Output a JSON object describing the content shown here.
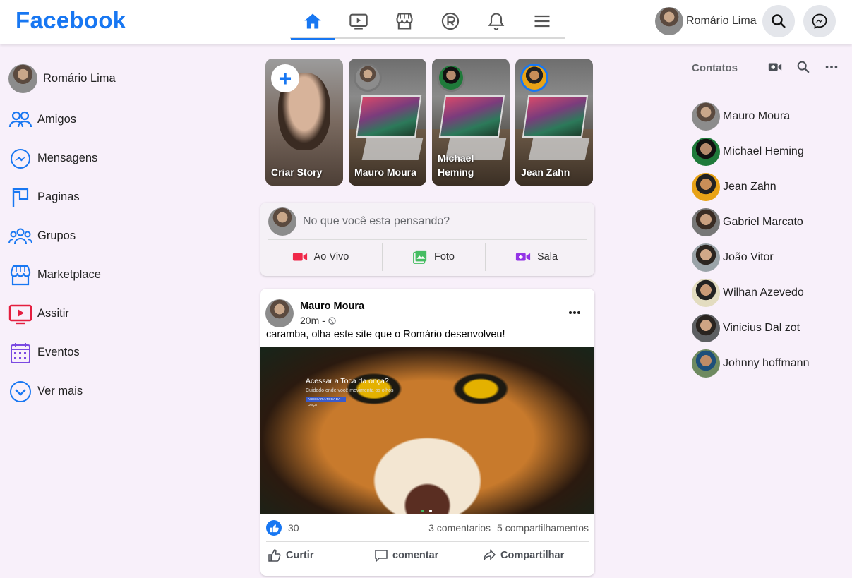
{
  "app": {
    "logo": "Facebook"
  },
  "header": {
    "nav": [
      {
        "id": "home",
        "icon": "home-icon",
        "active": true
      },
      {
        "id": "watch",
        "icon": "video-icon",
        "active": false
      },
      {
        "id": "marketplace",
        "icon": "store-icon",
        "active": false
      },
      {
        "id": "gaming",
        "icon": "gaming-icon",
        "active": false
      },
      {
        "id": "notifications",
        "icon": "bell-icon",
        "active": false
      },
      {
        "id": "menu",
        "icon": "hamburger-menu-icon",
        "active": false
      }
    ],
    "user_name": "Romário Lima",
    "search_icon": "search-icon",
    "messenger_icon": "messenger-icon"
  },
  "sidebar": {
    "user_name": "Romário Lima",
    "items": [
      {
        "label": "Amigos",
        "icon": "friends-icon",
        "color": "#1877f2"
      },
      {
        "label": "Mensagens",
        "icon": "messenger-icon",
        "color": "#1877f2"
      },
      {
        "label": "Paginas",
        "icon": "flag-icon",
        "color": "#1877f2"
      },
      {
        "label": "Grupos",
        "icon": "groups-icon",
        "color": "#1877f2"
      },
      {
        "label": "Marketplace",
        "icon": "store-icon",
        "color": "#1877f2"
      },
      {
        "label": "Assitir",
        "icon": "video-icon",
        "color": "#e41e3f"
      },
      {
        "label": "Eventos",
        "icon": "calendar-icon",
        "color": "#7b4ae2"
      },
      {
        "label": "Ver mais",
        "icon": "chevron-down-circle-icon",
        "color": "#1877f2"
      }
    ]
  },
  "stories": [
    {
      "name": "Criar Story",
      "type": "create"
    },
    {
      "name": "Mauro Moura",
      "type": "story"
    },
    {
      "name": "Michael Heming",
      "type": "story"
    },
    {
      "name": "Jean Zahn",
      "type": "story"
    }
  ],
  "composer": {
    "placeholder": "No que você esta pensando?",
    "actions": [
      {
        "label": "Ao Vivo",
        "icon": "live-video-icon",
        "color": "#f02849"
      },
      {
        "label": "Foto",
        "icon": "photo-icon",
        "color": "#45bd62"
      },
      {
        "label": "Sala",
        "icon": "room-icon",
        "color": "#9334e6"
      }
    ]
  },
  "post": {
    "author": "Mauro Moura",
    "time": "20m -",
    "text": "caramba, olha este site que o Romário desenvolveu!",
    "image": {
      "title": "Acessar a Toca da onça?",
      "subtitle": "Cuidado onde você movimenta os olhos",
      "button": "ACESSAR A TOCA DA ONÇA"
    },
    "likes": "30",
    "comments": "3 comentarios",
    "shares": "5 compartilhamentos",
    "actions": [
      {
        "label": "Curtir",
        "icon": "thumbs-up-icon"
      },
      {
        "label": "comentar",
        "icon": "comment-icon"
      },
      {
        "label": "Compartilhar",
        "icon": "share-icon"
      }
    ]
  },
  "contacts": {
    "title": "Contatos",
    "header_icons": [
      "video-call-icon",
      "search-icon",
      "more-icon"
    ],
    "people": [
      "Mauro Moura",
      "Michael Heming",
      "Jean Zahn",
      "Gabriel Marcato",
      "João Vitor",
      "Wilhan Azevedo",
      "Vinicius Dal zot",
      "Johnny hoffmann"
    ]
  },
  "colors": {
    "brand": "#1877f2",
    "background": "#f8f0fa",
    "topbar": "#ffffff"
  }
}
